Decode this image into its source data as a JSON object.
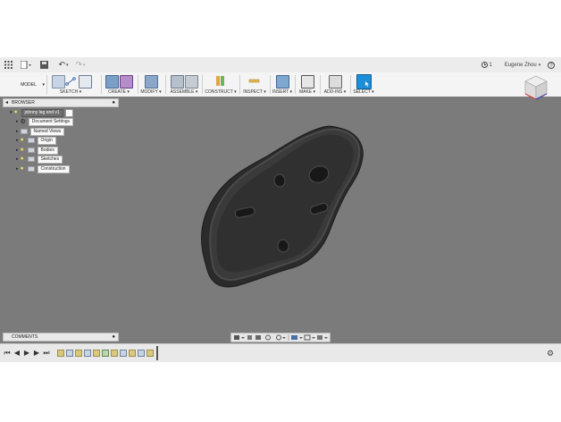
{
  "titlebar": {
    "undo_label": "↶",
    "redo_label": "↷",
    "job_count": "1",
    "user_name": "Eugene Zhou"
  },
  "workspace": {
    "label": "MODEL"
  },
  "ribbon": {
    "groups": [
      {
        "label": "SKETCH ▾"
      },
      {
        "label": "CREATE ▾"
      },
      {
        "label": "MODIFY ▾"
      },
      {
        "label": "ASSEMBLE ▾"
      },
      {
        "label": "CONSTRUCT ▾"
      },
      {
        "label": "INSPECT ▾"
      },
      {
        "label": "INSERT ▾"
      },
      {
        "label": "MAKE ▾"
      },
      {
        "label": "ADD-INS ▾"
      },
      {
        "label": "SELECT ▾"
      }
    ]
  },
  "browser": {
    "title": "BROWSER",
    "root": "johnny leg end v1",
    "items": [
      {
        "label": "Document Settings"
      },
      {
        "label": "Named Views"
      },
      {
        "label": "Origin"
      },
      {
        "label": "Bodies"
      },
      {
        "label": "Sketches"
      },
      {
        "label": "Construction"
      }
    ]
  },
  "comments": {
    "title": "COMMENTS"
  },
  "colors": {
    "viewport_bg": "#7b7b7b",
    "select_accent": "#1d8fd8",
    "part_color": "#2e2e2e"
  }
}
